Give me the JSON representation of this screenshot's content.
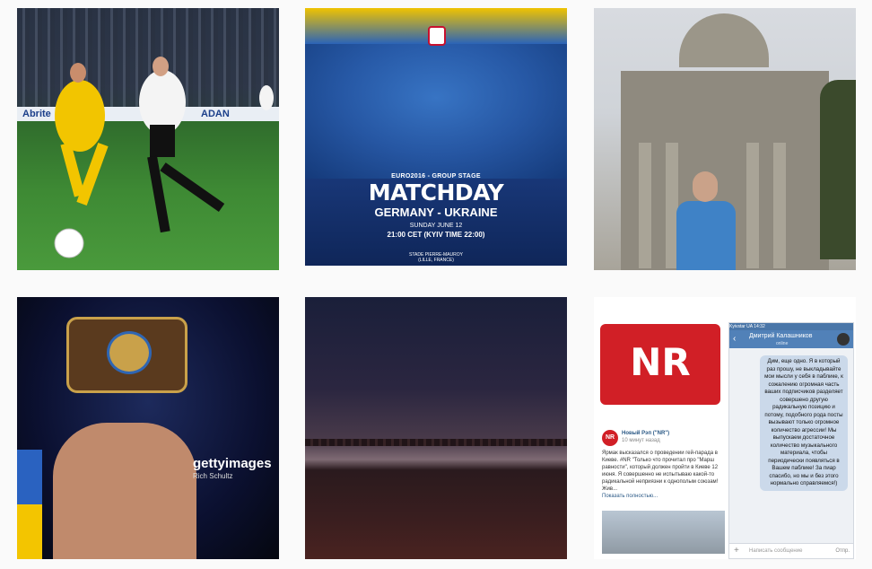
{
  "tiles": {
    "football": {
      "board_left": "Abrite",
      "board_right": "ADAN"
    },
    "matchday": {
      "stage": "EURO2016 - GROUP STAGE",
      "title": "MATCHDAY",
      "teams": "GERMANY - UKRAINE",
      "date": "SUNDAY JUNE 12",
      "time": "21:00 CET (KYIV TIME 22:00)",
      "venue_line1": "STADE PIERRE-MAUROY",
      "venue_line2": "(LILLE, FRANCE)"
    },
    "boxer": {
      "watermark": "gettyimages",
      "credit": "Rich Schultz"
    },
    "nr_post": {
      "logo_text": "NR",
      "small_logo": "NR",
      "author": "Новый Рэп (\"NR\")",
      "time_ago": "10 минут назад",
      "body": "Ярмак высказался о проведении гей-парада в Киеве. #NR \"Только что прочитал про \"Марш равности\", который должен пройти в Киеве 12 июня. Я совершенно не испытываю какой-то радикальной неприязни к однополым союзам! Жив...",
      "more": "Показать полностью...",
      "phone_status": "Kyivstar  UA   14:32",
      "chat_name": "Дмитрий Калашников",
      "chat_status": "online",
      "message": "Дим, еще одно. Я в который раз прошу, не выкладывайте мои мысли у себя в паблике, к сожалению огромная часть ваших подписчиков разделяет совершено другую радикальную позицию и потому, подобного рода посты вызывают только огромное количество агрессии! Мы выпускаем достаточное количество музыкального материала, чтобы периодически появляться в Вашем паблике! За пиар спасибо, но мы и без этого нормально справляемся!)",
      "input_placeholder": "Написать сообщение",
      "send_label": "Отпр."
    }
  },
  "colors": {
    "background": "#fafafa",
    "nr_red": "#d11f26",
    "vk_blue": "#5181b8",
    "ukraine_blue": "#2a62c0",
    "ukraine_yellow": "#f3c500"
  }
}
